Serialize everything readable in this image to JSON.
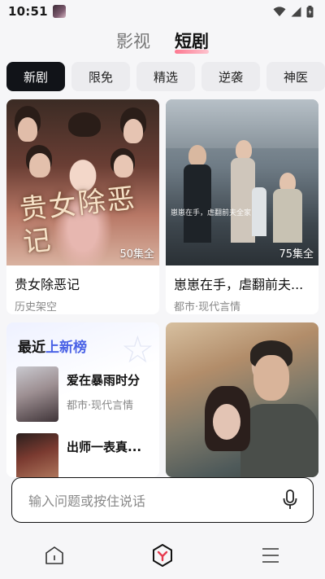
{
  "status_bar": {
    "time": "10:51"
  },
  "top_tabs": [
    {
      "label": "影视",
      "active": false
    },
    {
      "label": "短剧",
      "active": true
    }
  ],
  "categories": [
    "新剧",
    "限免",
    "精选",
    "逆袭",
    "神医"
  ],
  "cards": [
    {
      "title": "贵女除恶记",
      "genre": "历史架空",
      "episodes": "50集全",
      "poster_text": "贵女除恶记"
    },
    {
      "title": "崽崽在手，虐翻前夫...",
      "genre": "都市·现代言情",
      "episodes": "75集全",
      "poster_text": "崽崽在手，虐翻前夫全家"
    }
  ],
  "ranking": {
    "title_part1": "最近",
    "title_part2": "上新榜",
    "items": [
      {
        "name": "爱在暴雨时分",
        "genre": "都市·现代言情"
      },
      {
        "name": "出师一表真..."
      }
    ]
  },
  "input": {
    "placeholder": "输入问题或按住说话"
  },
  "bottom_nav": [
    {
      "icon": "home-icon"
    },
    {
      "icon": "center-logo-icon",
      "accent": "#e63b4f"
    },
    {
      "icon": "menu-icon"
    }
  ],
  "colors": {
    "accent_blue": "#4b63e6",
    "chip_active": "#111318",
    "logo_red": "#e63b4f"
  }
}
